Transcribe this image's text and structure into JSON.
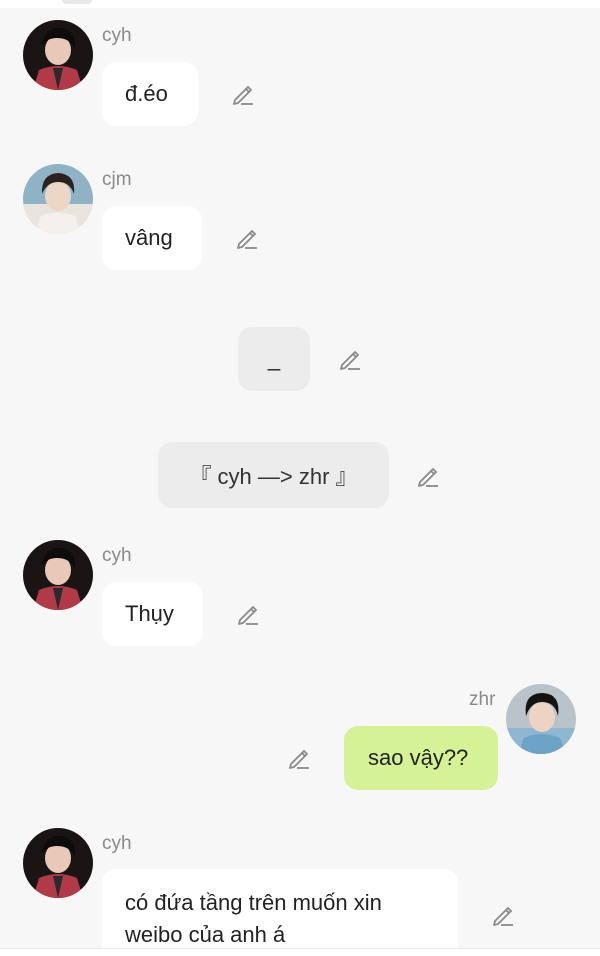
{
  "messages": [
    {
      "sender": "cyh",
      "text": "đ.éo"
    },
    {
      "sender": "cjm",
      "text": "vâng"
    },
    {
      "system": "_"
    },
    {
      "system": "『 cyh —> zhr 』"
    },
    {
      "sender": "cyh",
      "text": "Thụy"
    },
    {
      "sender": "zhr",
      "text": "sao vậy??"
    },
    {
      "sender": "cyh",
      "text": "có đứa tầng trên muốn xin weibo của anh á"
    }
  ],
  "icons": {
    "edit": "pencil-icon",
    "avatar": "avatar-photo"
  },
  "colors": {
    "background": "#f7f7f7",
    "bubble": "#ffffff",
    "own_bubble": "#d6f296",
    "system_bubble": "#ececec",
    "name": "#8a8a8a"
  }
}
